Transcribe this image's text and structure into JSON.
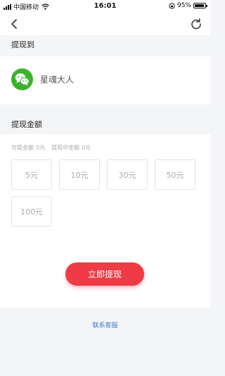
{
  "status_bar": {
    "carrier": "中国移动",
    "time": "16:01",
    "battery": "95%",
    "battery_level": 0.95
  },
  "nav": {
    "back_icon": "chevron-left-icon",
    "refresh_icon": "refresh-icon"
  },
  "withdraw_to": {
    "header": "提现到",
    "account_icon": "wechat-icon",
    "account_name": "星魂大人"
  },
  "withdraw_amount": {
    "header": "提现金额",
    "available_label": "可提金额",
    "available_value": "0元",
    "pending_label": "提现中金额",
    "pending_value": "0元",
    "options": [
      "5元",
      "10元",
      "30元",
      "50元",
      "100元"
    ],
    "submit_label": "立即提现"
  },
  "footer": {
    "contact_label": "联系客服"
  },
  "colors": {
    "accent_red": "#ee3b45",
    "wechat_green": "#3db12e",
    "link_blue": "#3a7bd5"
  }
}
